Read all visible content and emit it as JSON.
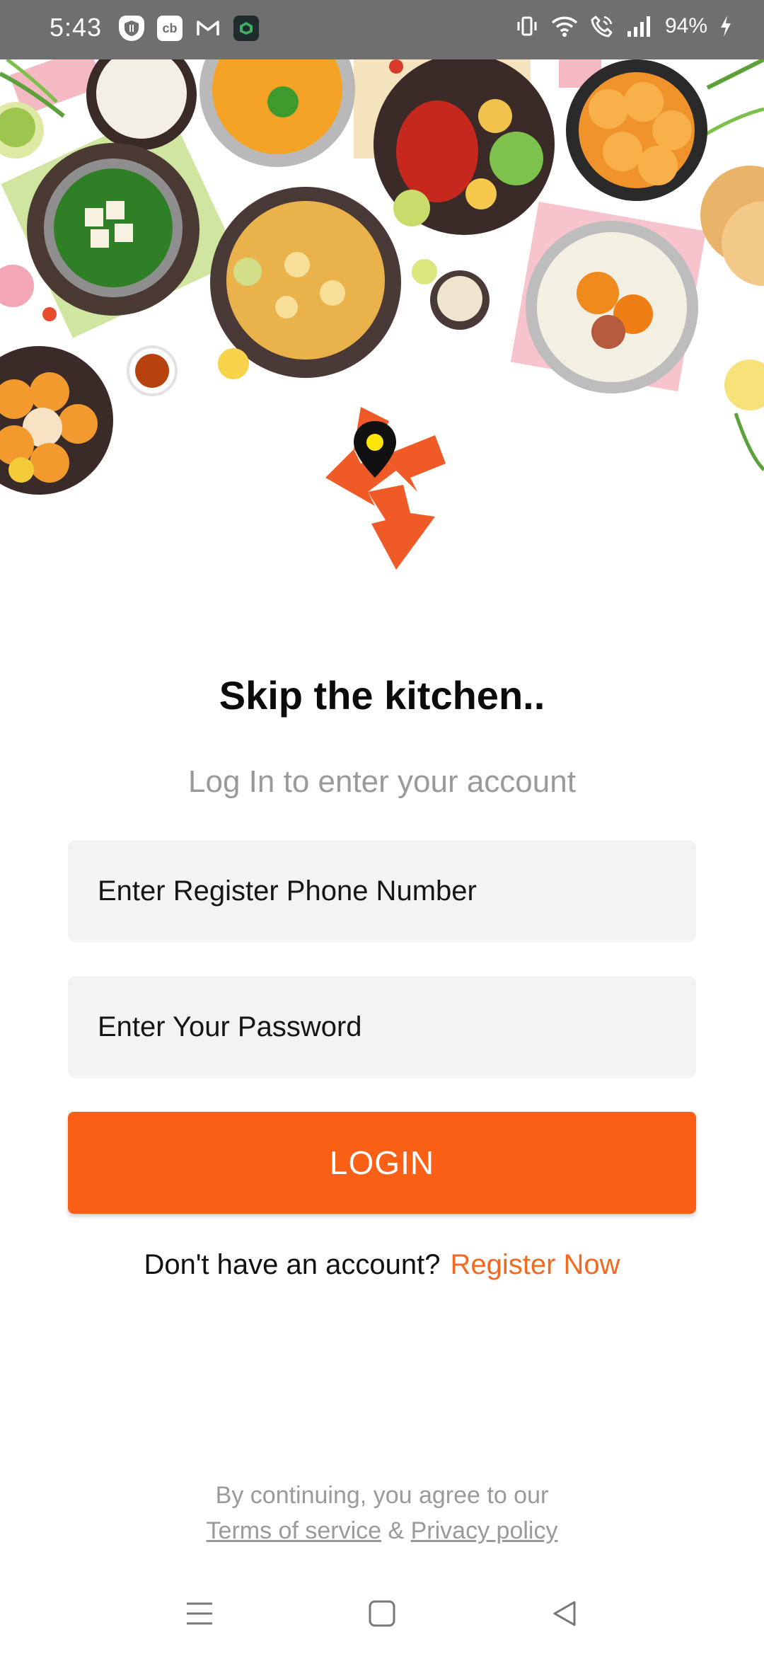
{
  "status_bar": {
    "time": "5:43",
    "battery": "94%",
    "left_icons": [
      "shield-icon",
      "cb-icon",
      "gmail-icon",
      "app-icon"
    ],
    "right_icons": [
      "vibrate-icon",
      "wifi-icon",
      "wifi-call-icon",
      "signal-icon",
      "battery-charging-icon"
    ],
    "cb_label": "cb"
  },
  "hero": {
    "description_icons": [
      "food-plate-icon"
    ]
  },
  "main": {
    "headline": "Skip the kitchen..",
    "subline": "Log In to enter your account",
    "phone_placeholder": "Enter Register Phone Number",
    "password_placeholder": "Enter Your Password",
    "login_label": "LOGIN",
    "register_prompt": "Don't have an account?",
    "register_link": "Register Now"
  },
  "legal": {
    "line1": "By continuing, you agree to our",
    "terms": "Terms of service",
    "amp": "&",
    "privacy": "Privacy policy"
  },
  "colors": {
    "accent": "#f96016",
    "link": "#f26a21",
    "input_bg": "#f3f3f3",
    "status_bar": "#6f6f6f",
    "muted_text": "#9a9a9a"
  }
}
